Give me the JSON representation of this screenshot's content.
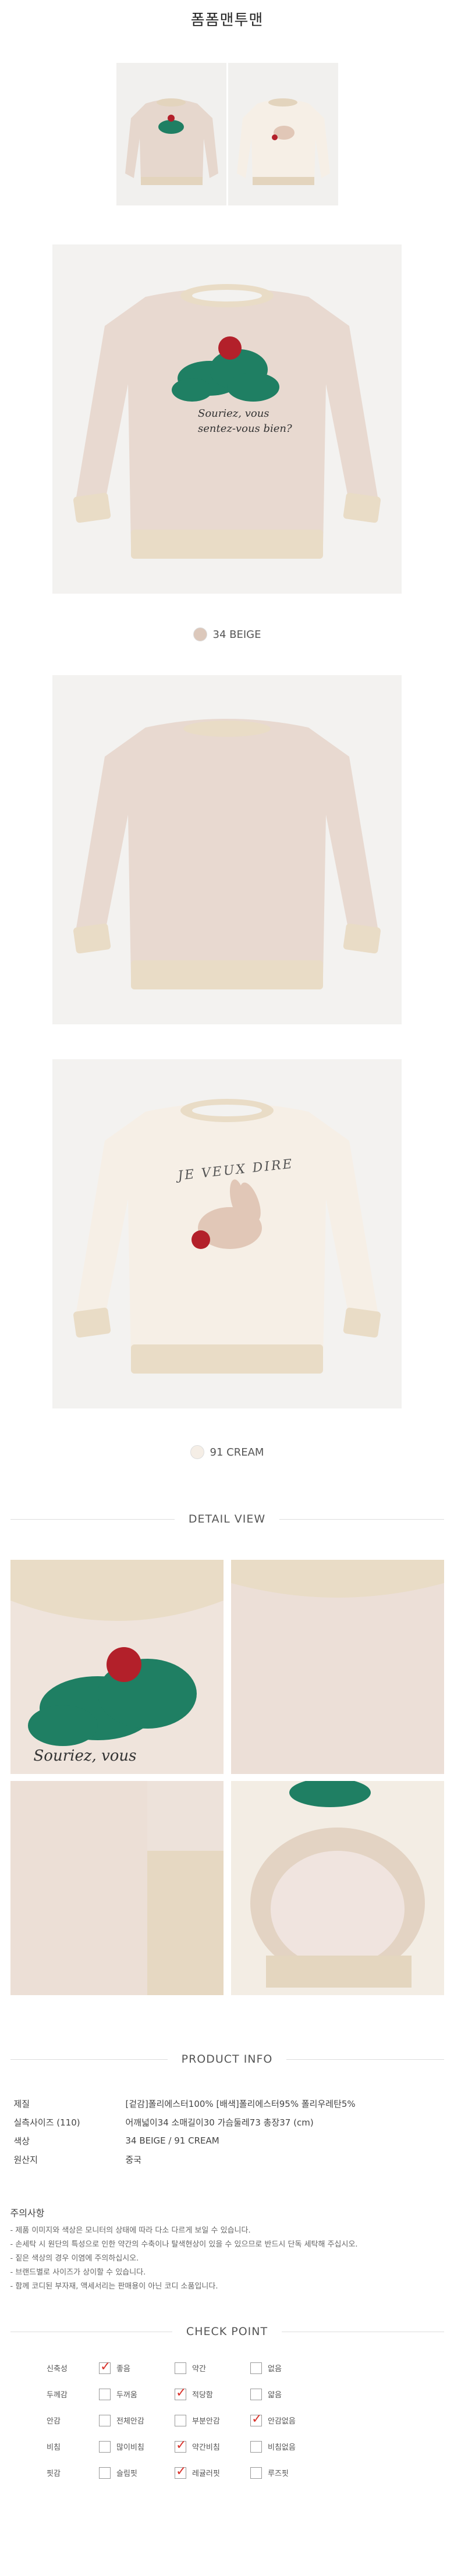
{
  "page_title": "폼폼맨투맨",
  "colors": {
    "beige": "#e8d9d0",
    "cream": "#f4ece2",
    "rib": "#e9dcc6",
    "cloud": "#1f7f63",
    "pompom": "#b3202a",
    "check_red": "#d9332c"
  },
  "thumbs": [
    {
      "name": "beige-thumb"
    },
    {
      "name": "cream-thumb"
    }
  ],
  "beige_swatch": {
    "label": "34 BEIGE",
    "color": "#dcc8bb"
  },
  "cream_swatch": {
    "label": "91 CREAM",
    "color": "#f5eee6"
  },
  "print_text_beige": [
    "Souriez, vous",
    "sentez-vous bien?"
  ],
  "print_text_cream": "JE VEUX DIRE",
  "detail_heading": "DETAIL VIEW",
  "detail_print": "Souriez, vous",
  "product_info_heading": "PRODUCT INFO",
  "product_info": [
    {
      "k": "제질",
      "v": "[겉감]폴리에스터100% [배색]폴리에스터95% 폴리우레탄5%"
    },
    {
      "k": "실측사이즈 (110)",
      "v": "어깨넓이34 소매길이30 가슴둘레73 총장37 (cm)"
    },
    {
      "k": "색상",
      "v": "34 BEIGE / 91 CREAM"
    },
    {
      "k": "원산지",
      "v": "중국"
    }
  ],
  "caution": {
    "head": "주의사항",
    "lines": [
      "- 제품 이미지와 색상은 모니터의 상태에 따라 다소 다르게 보일 수 있습니다.",
      "- 손세탁 시 원단의 특성으로 인한 약간의 수축이나 탈색현상이 있을 수 있으므로 반드시 단독 세탁해 주십시오.",
      "- 짙은 색상의 경우 이염에 주의하십시오.",
      "- 브랜드별로 사이즈가 상이할 수 있습니다.",
      "- 함께 코디된 부자재, 액세서리는 판매용이 아닌 코디 소품입니다."
    ]
  },
  "check_heading": "CHECK POINT",
  "check_rows": [
    {
      "cat": "신축성",
      "opts": [
        {
          "label": "좋음",
          "on": true
        },
        {
          "label": "약간",
          "on": false
        },
        {
          "label": "없음",
          "on": false
        }
      ]
    },
    {
      "cat": "두께감",
      "opts": [
        {
          "label": "두꺼움",
          "on": false
        },
        {
          "label": "적당함",
          "on": true
        },
        {
          "label": "얇음",
          "on": false
        }
      ]
    },
    {
      "cat": "안감",
      "opts": [
        {
          "label": "전체안감",
          "on": false
        },
        {
          "label": "부분안감",
          "on": false
        },
        {
          "label": "안감없음",
          "on": true
        }
      ]
    },
    {
      "cat": "비침",
      "opts": [
        {
          "label": "많이비침",
          "on": false
        },
        {
          "label": "약간비침",
          "on": true
        },
        {
          "label": "비침없음",
          "on": false
        }
      ]
    },
    {
      "cat": "핏감",
      "opts": [
        {
          "label": "슬림핏",
          "on": false
        },
        {
          "label": "레귤러핏",
          "on": true
        },
        {
          "label": "루즈핏",
          "on": false
        }
      ]
    }
  ]
}
